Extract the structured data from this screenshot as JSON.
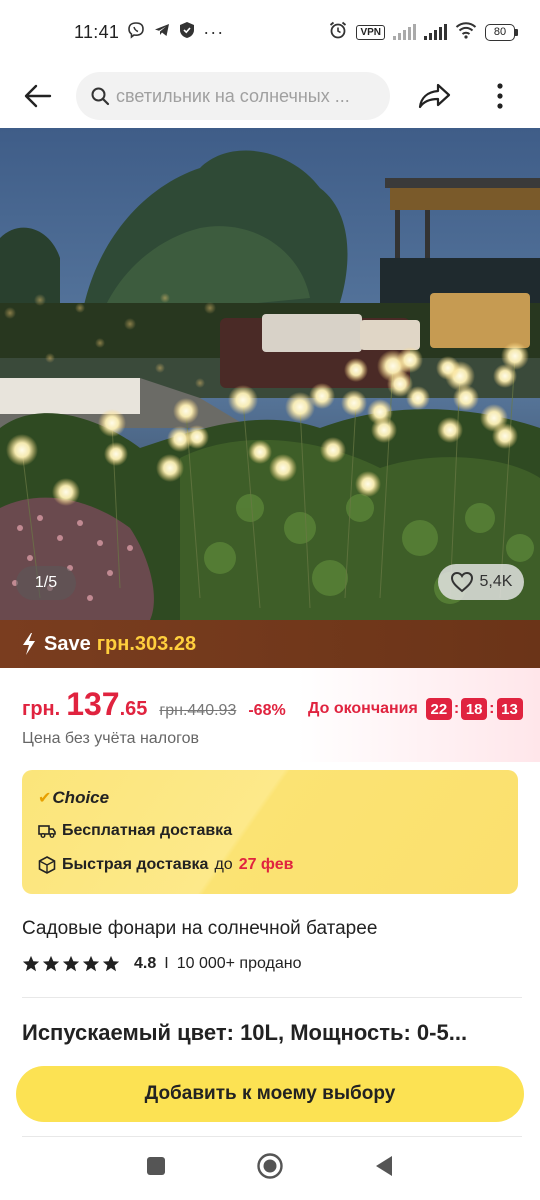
{
  "status_bar": {
    "time": "11:41",
    "left_icons": [
      "viber-icon",
      "telegram-icon",
      "shield-icon",
      "more-dots"
    ],
    "vpn": "VPN",
    "battery": "80"
  },
  "top_nav": {
    "search_placeholder": "светильник на солнечных ..."
  },
  "hero": {
    "page_indicator": "1/5",
    "likes": "5,4K"
  },
  "save_banner": {
    "label": "Save",
    "amount": "грн.303.28"
  },
  "price": {
    "currency": "грн.",
    "main": "137",
    "decimals": ".65",
    "old": "грн.440.93",
    "discount": "-68%",
    "countdown_label": "До окончания",
    "countdown": {
      "hh": "22",
      "mm": "18",
      "ss": "13"
    },
    "tax_note": "Цена без учёта налогов"
  },
  "choice": {
    "title": "Choice",
    "free_shipping": "Бесплатная доставка",
    "fast_prefix": "Быстрая доставка",
    "fast_mid": "до",
    "fast_date": "27 фев"
  },
  "product": {
    "title": "Садовые фонари на солнечной батарее",
    "rating": "4.8",
    "rating_sep": "I",
    "sold": "10 000+ продано",
    "stars_count": 5
  },
  "variant": {
    "title": "Испускаемый цвет: 10L, Мощность: 0-5..."
  },
  "cta": {
    "label": "Добавить к моему выбору"
  },
  "colors": {
    "accent_red": "#e0233f",
    "save_bg": "#6b3418",
    "choice_yellow": "#fbe373",
    "cta_yellow": "#fce253"
  }
}
